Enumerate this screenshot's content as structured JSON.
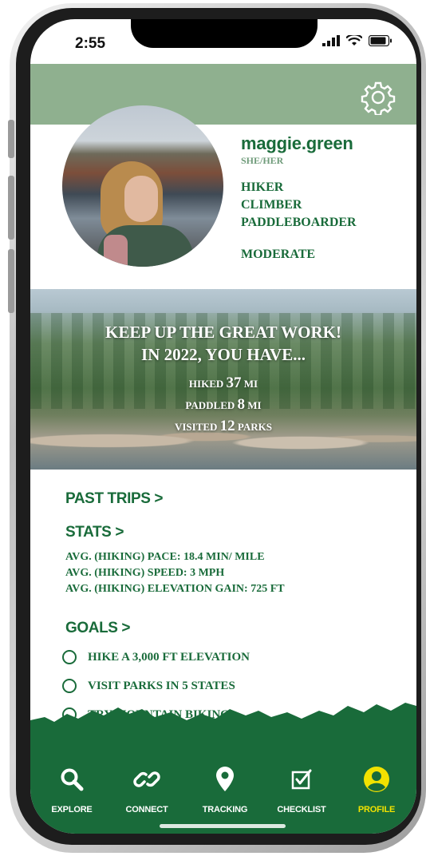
{
  "colors": {
    "brand_green": "#196b3a",
    "header_green": "#8fb08f",
    "accent_yellow": "#f2e200"
  },
  "status_bar": {
    "time": "2:55"
  },
  "profile": {
    "username": "maggie.green",
    "pronouns": "SHE/HER",
    "activities": [
      "HIKER",
      "CLIMBER",
      "PADDLEBOARDER"
    ],
    "level": "MODERATE"
  },
  "banner": {
    "line1": "KEEP UP THE GREAT WORK!",
    "line2": "IN 2022, YOU HAVE...",
    "stats": [
      {
        "verb": "HIKED",
        "value": "37",
        "unit": "MI"
      },
      {
        "verb": "PADDLED",
        "value": "8",
        "unit": "MI"
      },
      {
        "verb": "VISITED",
        "value": "12",
        "unit": "PARKS"
      }
    ]
  },
  "sections": {
    "past_trips": "PAST TRIPS >",
    "stats": "STATS >",
    "goals": "GOALS >"
  },
  "stats_lines": [
    "AVG. (HIKING) PACE: 18.4 MIN/ MILE",
    "AVG. (HIKING) SPEED: 3 MPH",
    "AVG. (HIKING) ELEVATION GAIN: 725 FT"
  ],
  "goals": [
    "HIKE  A 3,000 FT ELEVATION",
    "VISIT PARKS IN 5 STATES",
    "TRY MOUNTAIN BIKING"
  ],
  "nav": [
    {
      "label": "EXPLORE",
      "icon": "search-icon"
    },
    {
      "label": "CONNECT",
      "icon": "link-icon"
    },
    {
      "label": "TRACKING",
      "icon": "map-pin-icon"
    },
    {
      "label": "CHECKLIST",
      "icon": "checkbox-icon"
    },
    {
      "label": "PROFILE",
      "icon": "user-circle-icon",
      "active": true
    }
  ]
}
